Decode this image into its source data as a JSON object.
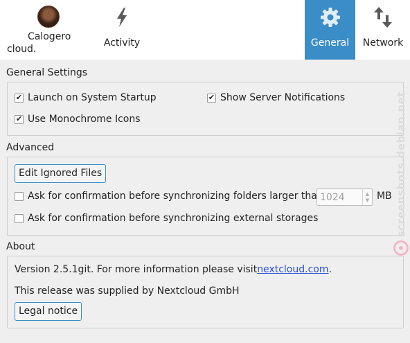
{
  "toolbar": {
    "account_line1": "Calogero",
    "account_line2": "cloud.",
    "activity_label": "Activity",
    "general_label": "General",
    "network_label": "Network"
  },
  "general": {
    "title": "General Settings",
    "launch_label": "Launch on System Startup",
    "launch_checked": true,
    "notifications_label": "Show Server Notifications",
    "notifications_checked": true,
    "monochrome_label": "Use Monochrome Icons",
    "monochrome_checked": true
  },
  "advanced": {
    "title": "Advanced",
    "edit_ignored_label": "Edit Ignored Files",
    "confirm_large_label": "Ask for confirmation before synchronizing folders larger than",
    "confirm_large_checked": false,
    "size_value": "1024",
    "size_unit": "MB",
    "confirm_external_label": "Ask for confirmation before synchronizing external storages",
    "confirm_external_checked": false
  },
  "about": {
    "title": "About",
    "version_text": "Version 2.5.1git. For more information please visit ",
    "version_link": "nextcloud.com",
    "version_suffix": ".",
    "supplier_text": "This release was supplied by Nextcloud GmbH",
    "legal_label": "Legal notice"
  },
  "watermark": "screenshots.debian.net",
  "colors": {
    "accent": "#3b8dc7",
    "background": "#efefef",
    "link": "#2a4fd6"
  }
}
